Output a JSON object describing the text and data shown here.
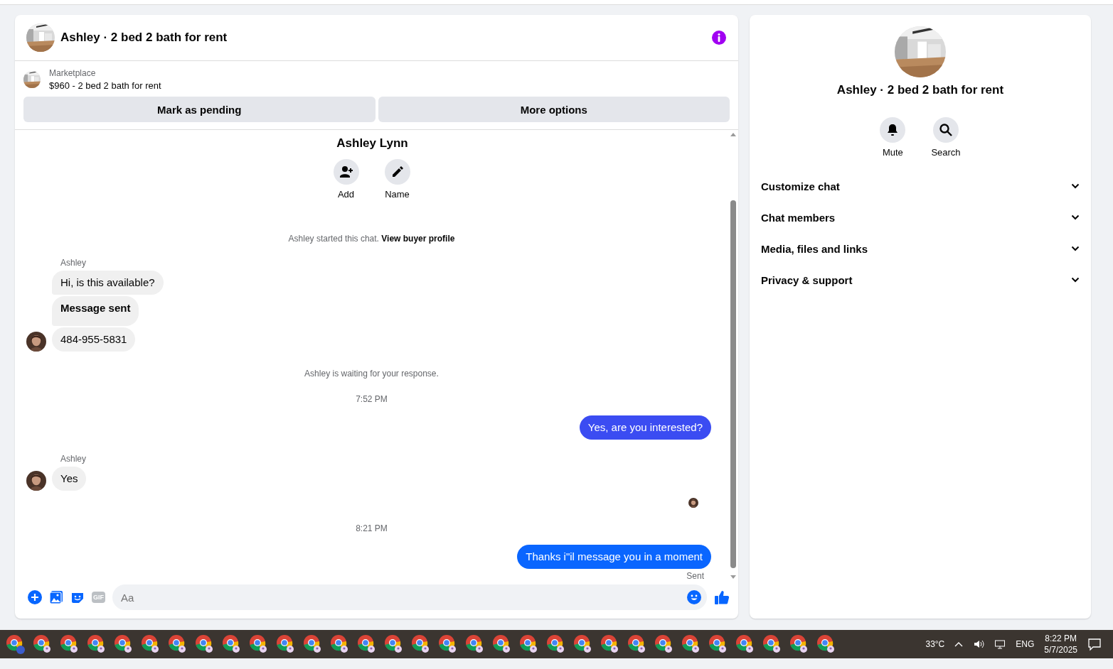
{
  "chat": {
    "title": "Ashley · 2 bed 2 bath for rent",
    "listing": {
      "source": "Marketplace",
      "summary": "$960 - 2 bed 2 bath for rent",
      "buttons": [
        "Mark as pending",
        "More options"
      ]
    },
    "profile": {
      "name": "Ashley Lynn",
      "actions": [
        {
          "kind": "add",
          "label": "Add"
        },
        {
          "kind": "name",
          "label": "Name"
        }
      ]
    },
    "messages": [
      {
        "kind": "meta",
        "text": "Ashley started this chat. **View buyer profile**"
      },
      {
        "kind": "sender",
        "text": "Ashley"
      },
      {
        "kind": "incoming",
        "text": "Hi, is this available?",
        "bold": false,
        "avatar": false
      },
      {
        "kind": "incoming",
        "text": "Message sent",
        "bold": true,
        "avatar": false
      },
      {
        "kind": "incoming",
        "text": "484-955-5831",
        "bold": false,
        "avatar": true
      },
      {
        "kind": "status",
        "text": "Ashley is waiting for your response."
      },
      {
        "kind": "time",
        "text": "7:52 PM"
      },
      {
        "kind": "outgoing",
        "text": "Yes, are you interested?",
        "color": "#3b4cf2"
      },
      {
        "kind": "sender",
        "text": "Ashley"
      },
      {
        "kind": "incoming",
        "text": "Yes",
        "bold": false,
        "avatar": true
      },
      {
        "kind": "seen"
      },
      {
        "kind": "time",
        "text": "8:21 PM"
      },
      {
        "kind": "outgoing",
        "text": "Thanks i\"il message you in a moment",
        "color": "#0a66ff"
      },
      {
        "kind": "receipt",
        "text": "Sent"
      }
    ],
    "composer": {
      "placeholder": "Aa",
      "gif": "GIF"
    }
  },
  "details": {
    "title": "Ashley · 2 bed 2 bath for rent",
    "actions": [
      {
        "kind": "mute",
        "label": "Mute"
      },
      {
        "kind": "search",
        "label": "Search"
      }
    ],
    "sections": [
      {
        "label": "Customize chat",
        "expanded": false
      },
      {
        "label": "Chat members",
        "expanded": false
      },
      {
        "label": "Media, files and links",
        "expanded": false
      },
      {
        "label": "Privacy & support",
        "expanded": false
      }
    ]
  },
  "taskbar": {
    "weather": "33°C",
    "language": "ENG",
    "time": "8:22 PM",
    "date": "5/7/2025"
  }
}
